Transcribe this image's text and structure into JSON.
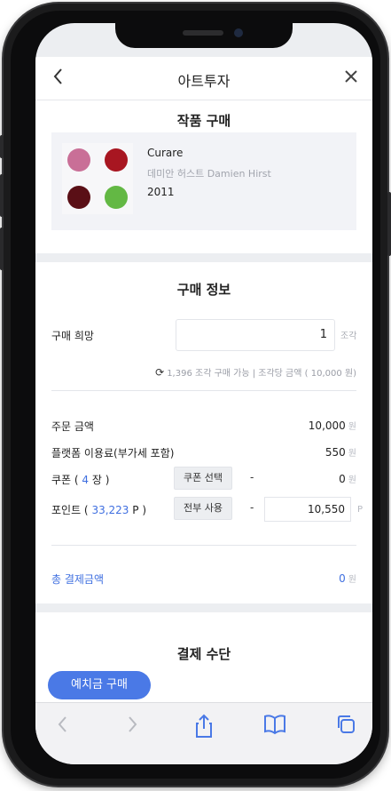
{
  "header": {
    "back_icon": "chevron-left-icon",
    "title": "아트투자",
    "close_icon": "close-icon"
  },
  "artwork_section": {
    "title": "작품 구매",
    "artwork": {
      "name": "Curare",
      "artist": "데미안 허스트 Damien Hirst",
      "year": "2011",
      "dot_colors": [
        "#c96f97",
        "#a81621",
        "#5a0f16",
        "#63b844"
      ]
    }
  },
  "purchase_info": {
    "title": "구매 정보",
    "quantity_label": "구매 희망",
    "quantity_value": "1",
    "quantity_unit": "조각",
    "availability": "1,396 조각 구매 가능 | 조각당 금액 ( 10,000 원)",
    "order_amount_label": "주문 금액",
    "order_amount": "10,000",
    "fee_label": "플랫폼 이용료(부가세 포함)",
    "fee": "550",
    "coupon_prefix": "쿠폰 (",
    "coupon_count": "4",
    "coupon_suffix": "장 )",
    "coupon_select": "쿠폰 선택",
    "coupon_amount": "0",
    "point_prefix": "포인트 (",
    "point_balance": "33,223",
    "point_suffix": "P )",
    "point_use_all": "전부 사용",
    "point_value": "10,550",
    "point_unit": "P",
    "dash": "-",
    "won": "원",
    "total_label": "총 결제금액",
    "total_amount": "0"
  },
  "payment": {
    "title": "결제 수단",
    "method_button": "예치금 구매"
  },
  "browser_toolbar": {
    "back_icon": "chevron-left-icon",
    "forward_icon": "chevron-right-icon",
    "share_icon": "share-icon",
    "bookmarks_icon": "book-icon",
    "tabs_icon": "tabs-icon"
  },
  "colors": {
    "accent": "#4a79e6",
    "link": "#3f6fe0",
    "background": "#eceef1"
  }
}
